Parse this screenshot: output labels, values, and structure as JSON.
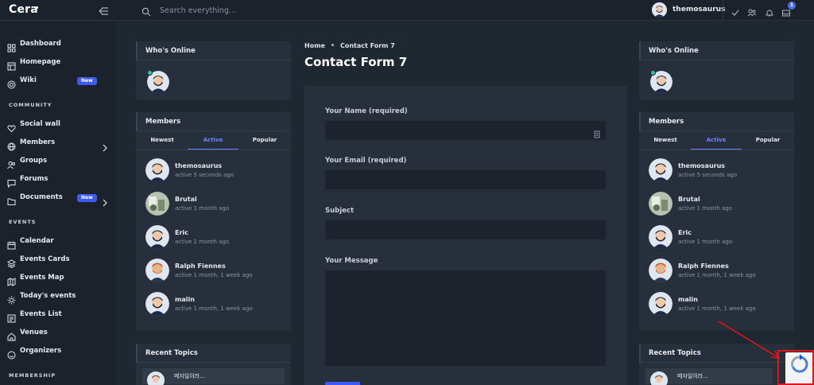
{
  "app": {
    "logo": "Cera"
  },
  "topbar": {
    "search_placeholder": "Search everything...",
    "username": "themosaurus",
    "notification_count": "1"
  },
  "sidebar": {
    "items_top": [
      {
        "label": "Dashboard",
        "icon": "grid-icon"
      },
      {
        "label": "Homepage",
        "icon": "layout-icon"
      },
      {
        "label": "Wiki",
        "icon": "lifebuoy-icon",
        "badge": "New"
      }
    ],
    "community_title": "COMMUNITY",
    "community": [
      {
        "label": "Social wall",
        "icon": "heart-icon"
      },
      {
        "label": "Members",
        "icon": "globe-icon",
        "chevron": true
      },
      {
        "label": "Groups",
        "icon": "users-icon"
      },
      {
        "label": "Forums",
        "icon": "chat-icon"
      },
      {
        "label": "Documents",
        "icon": "folder-icon",
        "badge": "New",
        "chevron": true
      }
    ],
    "events_title": "EVENTS",
    "events": [
      {
        "label": "Calendar",
        "icon": "calendar-icon"
      },
      {
        "label": "Events Cards",
        "icon": "layers-icon"
      },
      {
        "label": "Events Map",
        "icon": "map-icon"
      },
      {
        "label": "Today's events",
        "icon": "sun-icon"
      },
      {
        "label": "Events List",
        "icon": "list-icon"
      },
      {
        "label": "Venues",
        "icon": "home-icon"
      },
      {
        "label": "Organizers",
        "icon": "smile-icon"
      }
    ],
    "membership_title": "MEMBERSHIP"
  },
  "widgets": {
    "whos_online_title": "Who's Online",
    "members_title": "Members",
    "tabs": [
      "Newest",
      "Active",
      "Popular"
    ],
    "members": [
      {
        "name": "themosaurus",
        "status": "active 5 seconds ago",
        "avatar": "avatar-bearded"
      },
      {
        "name": "Brutal",
        "status": "active 1 month ago",
        "avatar": "avatar-photo"
      },
      {
        "name": "Eric",
        "status": "active 1 month ago",
        "avatar": "avatar-bearded"
      },
      {
        "name": "Ralph Fiennes",
        "status": "active 1 month, 1 week ago",
        "avatar": "avatar-orange"
      },
      {
        "name": "malin",
        "status": "active 1 month, 1 week ago",
        "avatar": "avatar-bearded"
      }
    ],
    "recent_topics_title": "Recent Topics",
    "recent_topic": "메자일이라..."
  },
  "main": {
    "breadcrumb_home": "Home",
    "breadcrumb_current": "Contact Form 7",
    "title": "Contact Form 7",
    "form": {
      "name_label": "Your Name (required)",
      "email_label": "Your Email (required)",
      "subject_label": "Subject",
      "message_label": "Your Message"
    }
  },
  "colors": {
    "accent": "#3d5afe",
    "highlight": "#e0161e",
    "online": "#2ec4a4"
  }
}
